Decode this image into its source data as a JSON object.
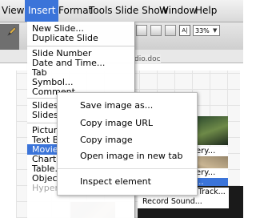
{
  "menubar": {
    "items": [
      "View",
      "Insert",
      "Format",
      "Tools",
      "Slide Show",
      "Window",
      "Help"
    ],
    "active": "Insert"
  },
  "toolbar": {
    "zoom": "33%"
  },
  "document": {
    "tab_fragment": "dio.doc"
  },
  "insert_menu": {
    "items": [
      "New Slide...",
      "Duplicate Slide",
      "Slide Number",
      "Date and Time...",
      "Tab",
      "Symbol...",
      "Comment",
      "Slides fr",
      "Slides fr",
      "Picture",
      "Text Bo",
      "Movies",
      "Chart...",
      "Table...",
      "Object...",
      "Hyperlin"
    ],
    "highlighted": "Movies",
    "disabled": "Hyperlin"
  },
  "context_menu": {
    "items": [
      "Save image as...",
      "Copy image URL",
      "Copy image",
      "Open image in new tab",
      "Inspect element"
    ]
  },
  "submenu_fragments": {
    "frag1": "ery...",
    "frag2": "ery...",
    "frag3": "e...",
    "frag4": "..."
  },
  "bottom_submenu": {
    "items": [
      "Play CD Audio Track...",
      "Record Sound..."
    ]
  },
  "colors": {
    "highlight": "#3b74d9",
    "menubar": "#e6e6e6"
  }
}
